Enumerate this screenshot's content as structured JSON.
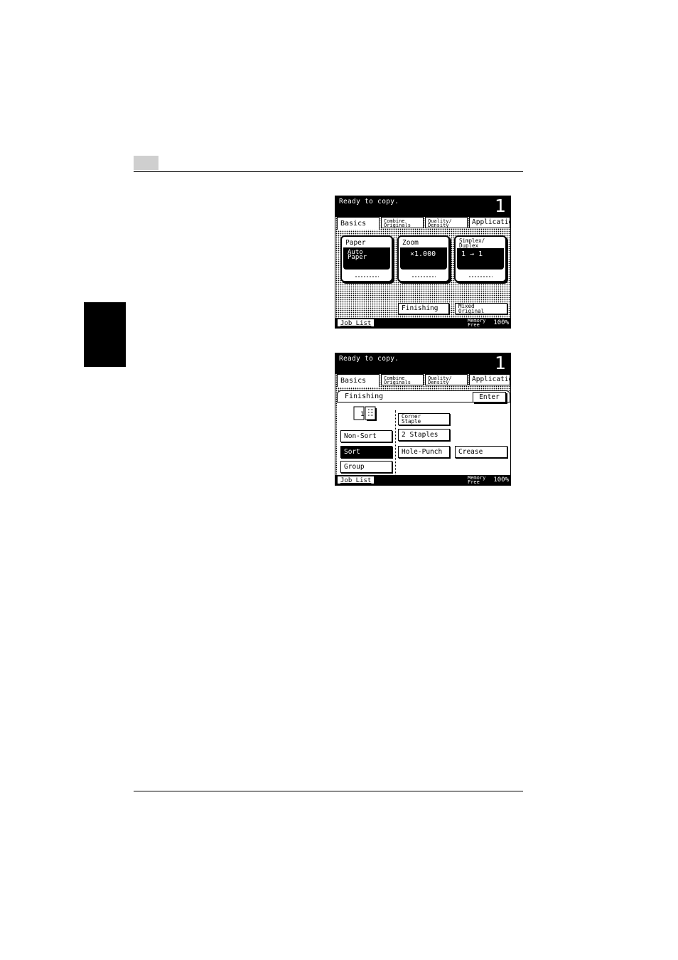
{
  "panel1": {
    "status": "Ready to copy.",
    "count": "1",
    "tabs": {
      "basics": "Basics",
      "combine_1": "Combine",
      "combine_2": "Originals",
      "quality_1": "Quality/",
      "quality_2": "Density",
      "application": "Application"
    },
    "paper": {
      "title": "Paper",
      "value_1": "Auto",
      "value_2": "Paper"
    },
    "zoom": {
      "title": "Zoom",
      "value": "×1.000"
    },
    "simplex": {
      "title_1": "Simplex/",
      "title_2": "Duplex",
      "value": "1 → 1"
    },
    "finishing": "Finishing",
    "mixed_1": "Mixed",
    "mixed_2": "Original",
    "job_list": "Job List",
    "memory_1": "Memory",
    "memory_2": "Free",
    "memory_pct": "100%"
  },
  "panel2": {
    "status": "Ready to copy.",
    "count": "1",
    "tabs": {
      "basics": "Basics",
      "combine_1": "Combine",
      "combine_2": "Originals",
      "quality_1": "Quality/",
      "quality_2": "Density",
      "application": "Application"
    },
    "header": "Finishing",
    "enter": "Enter",
    "sort_icon_digit": "1",
    "non_sort": "Non-Sort",
    "sort": "Sort",
    "group": "Group",
    "corner_1": "Corner",
    "corner_2": "Staple",
    "two_staples": "2 Staples",
    "hole_punch": "Hole-Punch",
    "crease": "Crease",
    "job_list": "Job List",
    "memory_1": "Memory",
    "memory_2": "Free",
    "memory_pct": "100%"
  }
}
